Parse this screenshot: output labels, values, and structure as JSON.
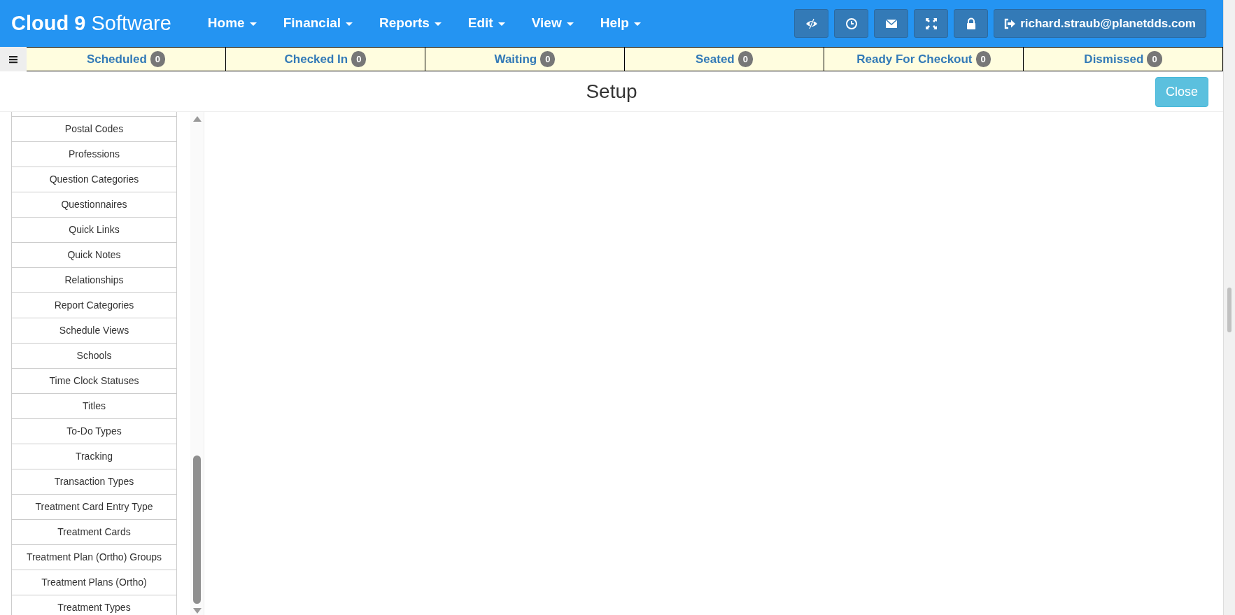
{
  "brand": {
    "bold": "Cloud 9",
    "light": "Software"
  },
  "menu": [
    {
      "label": "Home"
    },
    {
      "label": "Financial"
    },
    {
      "label": "Reports"
    },
    {
      "label": "Edit"
    },
    {
      "label": "View"
    },
    {
      "label": "Help"
    }
  ],
  "toolbar_buttons": [
    {
      "kind": "eye-slash"
    },
    {
      "kind": "clock"
    },
    {
      "kind": "envelope"
    },
    {
      "kind": "expand"
    },
    {
      "kind": "lock"
    }
  ],
  "user_button": "richard.straub@planetdds.com",
  "status_tabs": [
    {
      "label": "Scheduled",
      "count": "0"
    },
    {
      "label": "Checked In",
      "count": "0"
    },
    {
      "label": "Waiting",
      "count": "0"
    },
    {
      "label": "Seated",
      "count": "0"
    },
    {
      "label": "Ready For Checkout",
      "count": "0"
    },
    {
      "label": "Dismissed",
      "count": "0"
    }
  ],
  "page_title": "Setup",
  "close_button": "Close",
  "setup_items": [
    "Postal Codes",
    "Professions",
    "Question Categories",
    "Questionnaires",
    "Quick Links",
    "Quick Notes",
    "Relationships",
    "Report Categories",
    "Schedule Views",
    "Schools",
    "Time Clock Statuses",
    "Titles",
    "To-Do Types",
    "Tracking",
    "Transaction Types",
    "Treatment Card Entry Type",
    "Treatment Cards",
    "Treatment Plan (Ortho) Groups",
    "Treatment Plans (Ortho)",
    "Treatment Types"
  ]
}
